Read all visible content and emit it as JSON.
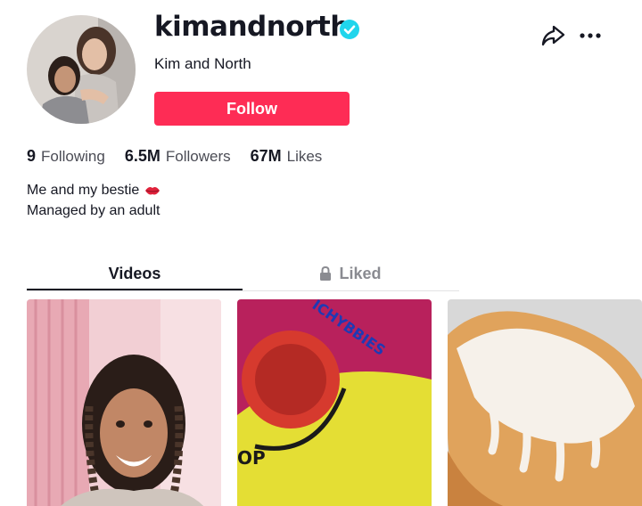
{
  "profile": {
    "username": "kimandnorth",
    "nickname": "Kim and North",
    "verified": true,
    "follow_label": "Follow",
    "avatar_alt": "avatar"
  },
  "stats": {
    "following_count": "9",
    "following_label": "Following",
    "followers_count": "6.5M",
    "followers_label": "Followers",
    "likes_count": "67M",
    "likes_label": "Likes"
  },
  "bio": {
    "line1": "Me and my bestie",
    "line2": "Managed by an adult"
  },
  "tabs": {
    "videos_label": "Videos",
    "liked_label": "Liked",
    "active": "videos"
  },
  "videos": [
    {
      "thumb": "girl-braids-pink-room"
    },
    {
      "thumb": "yellow-pink-package"
    },
    {
      "thumb": "frosted-pastry"
    }
  ],
  "video_labels": {
    "package_text": "ICHYBBIES",
    "package_bottom_text": "OP"
  },
  "icons": {
    "verified": "verified-check-icon",
    "share": "share-arrow-icon",
    "more": "more-dots-icon",
    "lock": "lock-icon",
    "lips": "lips-kiss-icon"
  },
  "colors": {
    "accent": "#fe2c55",
    "verified": "#20d5ec",
    "text": "#161823",
    "muted": "#8a8b91"
  }
}
